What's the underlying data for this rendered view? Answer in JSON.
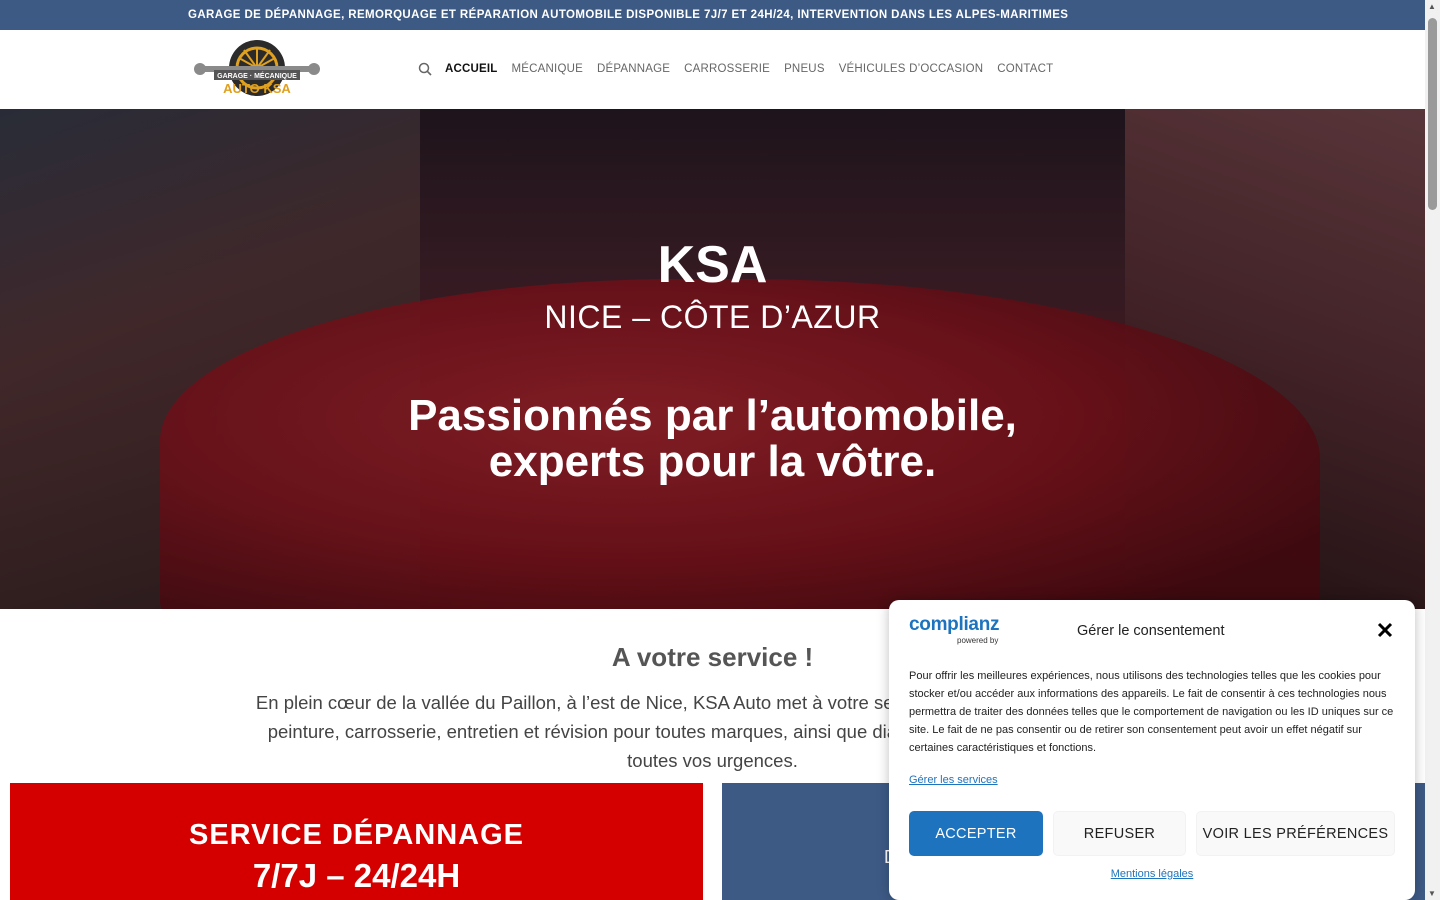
{
  "topbar": {
    "text": "GARAGE DE DÉPANNAGE, REMORQUAGE ET RÉPARATION AUTOMOBILE DISPONIBLE 7J/7 ET 24H/24, INTERVENTION DANS LES ALPES-MARITIMES"
  },
  "logo": {
    "line1": "GARAGE · MÉCANIQUE",
    "line2": "AUTO KSA"
  },
  "nav": {
    "search_icon": "search-icon",
    "items": [
      {
        "label": "ACCUEIL",
        "active": true
      },
      {
        "label": "MÉCANIQUE"
      },
      {
        "label": "DÉPANNAGE"
      },
      {
        "label": "CARROSSERIE"
      },
      {
        "label": "PNEUS"
      },
      {
        "label": "VÉHICULES D’OCCASION"
      },
      {
        "label": "CONTACT"
      }
    ]
  },
  "hero": {
    "title": "KSA",
    "subtitle": "NICE – CÔTE D’AZUR",
    "tagline_line1": "Passionnés par l’automobile,",
    "tagline_line2": "experts pour la vôtre."
  },
  "service": {
    "title": "A votre service !",
    "line1": "En plein cœur de la vallée du Paillon, à l’est de Nice, KSA Auto met à votre service son expertise et son expérie",
    "line2": "peinture, carrosserie, entretien et révision pour toutes marques, ainsi que diagnostic électronique. Dépannag",
    "line3": "toutes vos urgences."
  },
  "cards": {
    "red_line1": "SERVICE DÉPANNAGE",
    "red_line2": "7/7J – 24/24H",
    "blue_partial": "D"
  },
  "consent": {
    "brand": "complianz",
    "powered": "powered by",
    "title": "Gérer le consentement",
    "message": "Pour offrir les meilleures expériences, nous utilisons des technologies telles que les cookies pour stocker et/ou accéder aux informations des appareils. Le fait de consentir à ces technologies nous permettra de traiter des données telles que le comportement de navigation ou les ID uniques sur ce site. Le fait de ne pas consentir ou de retirer son consentement peut avoir un effet négatif sur certaines caractéristiques et fonctions.",
    "manage_services": "Gérer les services",
    "accept": "ACCEPTER",
    "refuse": "REFUSER",
    "preferences": "VOIR LES PRÉFÉRENCES",
    "legal": "Mentions légales"
  },
  "colors": {
    "topbar": "#3d5a85",
    "accent_red": "#d40000",
    "link_blue": "#1e73be"
  }
}
